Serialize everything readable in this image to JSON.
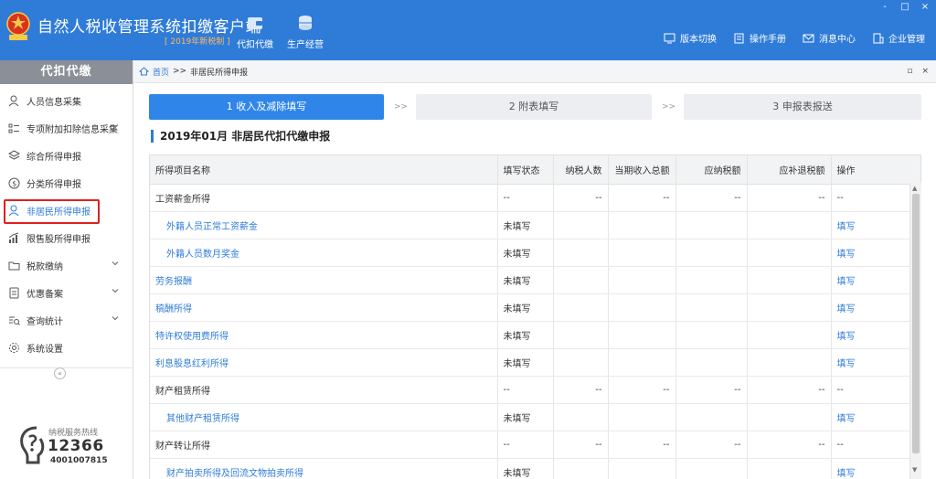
{
  "app": {
    "title": "自然人税收管理系统扣缴客户端",
    "subtitle": "[ 2019年新税制 ]",
    "nav": [
      {
        "label": "代扣代缴",
        "icon": "wallet-icon"
      },
      {
        "label": "生产经营",
        "icon": "coins-icon"
      }
    ],
    "header_links": [
      {
        "label": "版本切换",
        "icon": "switch-icon"
      },
      {
        "label": "操作手册",
        "icon": "manual-icon"
      },
      {
        "label": "消息中心",
        "icon": "mail-icon"
      },
      {
        "label": "企业管理",
        "icon": "building-icon"
      }
    ],
    "window_controls": [
      "-",
      "□",
      "×"
    ]
  },
  "sidebar": {
    "header": "代扣代缴",
    "items": [
      {
        "label": "人员信息采集",
        "icon": "person-icon"
      },
      {
        "label": "专项附加扣除信息采集",
        "icon": "list-icon",
        "has_chevron": true
      },
      {
        "label": "综合所得申报",
        "icon": "layers-icon"
      },
      {
        "label": "分类所得申报",
        "icon": "dollar-icon"
      },
      {
        "label": "非居民所得申报",
        "icon": "person-icon",
        "active": true
      },
      {
        "label": "限售股所得申报",
        "icon": "chart-icon"
      },
      {
        "label": "税款缴纳",
        "icon": "folder-icon",
        "has_chevron": true
      },
      {
        "label": "优惠备案",
        "icon": "document-icon",
        "has_chevron": true
      },
      {
        "label": "查询统计",
        "icon": "search-list-icon",
        "has_chevron": true
      },
      {
        "label": "系统设置",
        "icon": "gear-icon"
      }
    ],
    "collapse_glyph": "«",
    "hotline": {
      "label": "纳税服务热线",
      "number": "12366",
      "number2": "4001007815"
    }
  },
  "breadcrumb": {
    "home": "首页",
    "separator": ">>",
    "current": "非居民所得申报",
    "controls": [
      "▫",
      "×"
    ]
  },
  "steps": [
    {
      "label": "1 收入及减除填写",
      "active": true
    },
    {
      "label": "2 附表填写",
      "active": false
    },
    {
      "label": "3 申报表报送",
      "active": false
    }
  ],
  "step_arrow": ">>",
  "section_title": "2019年01月  非居民代扣代缴申报",
  "table": {
    "headers": [
      "所得项目名称",
      "填写状态",
      "纳税人数",
      "当期收入总额",
      "应纳税额",
      "应补退税额",
      "操作"
    ],
    "rows": [
      {
        "name": "工资薪金所得",
        "status": "--",
        "count": "--",
        "income": "--",
        "tax": "--",
        "refund": "--",
        "op": "--",
        "kind": "group"
      },
      {
        "name": "外籍人员正常工资薪金",
        "status": "未填写",
        "count": "",
        "income": "",
        "tax": "",
        "refund": "",
        "op": "填写",
        "kind": "sub"
      },
      {
        "name": "外籍人员数月奖金",
        "status": "未填写",
        "count": "",
        "income": "",
        "tax": "",
        "refund": "",
        "op": "填写",
        "kind": "sub"
      },
      {
        "name": "劳务报酬",
        "status": "未填写",
        "count": "",
        "income": "",
        "tax": "",
        "refund": "",
        "op": "填写",
        "kind": "link"
      },
      {
        "name": "稿酬所得",
        "status": "未填写",
        "count": "",
        "income": "",
        "tax": "",
        "refund": "",
        "op": "填写",
        "kind": "link"
      },
      {
        "name": "特许权使用费所得",
        "status": "未填写",
        "count": "",
        "income": "",
        "tax": "",
        "refund": "",
        "op": "填写",
        "kind": "link"
      },
      {
        "name": "利息股息红利所得",
        "status": "未填写",
        "count": "",
        "income": "",
        "tax": "",
        "refund": "",
        "op": "填写",
        "kind": "link"
      },
      {
        "name": "财产租赁所得",
        "status": "--",
        "count": "--",
        "income": "--",
        "tax": "--",
        "refund": "--",
        "op": "--",
        "kind": "group"
      },
      {
        "name": "其他财产租赁所得",
        "status": "未填写",
        "count": "",
        "income": "",
        "tax": "",
        "refund": "",
        "op": "填写",
        "kind": "sub"
      },
      {
        "name": "财产转让所得",
        "status": "--",
        "count": "--",
        "income": "--",
        "tax": "--",
        "refund": "--",
        "op": "--",
        "kind": "group"
      },
      {
        "name": "财产拍卖所得及回流文物拍卖所得",
        "status": "未填写",
        "count": "",
        "income": "",
        "tax": "",
        "refund": "",
        "op": "填写",
        "kind": "sub"
      }
    ]
  },
  "colors": {
    "primary": "#2f7cd8",
    "highlight_box": "#e02020",
    "subtitle": "#ffb860"
  }
}
